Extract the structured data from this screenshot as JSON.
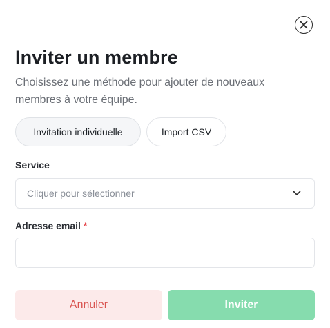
{
  "dialog": {
    "close_icon": "close-circle-icon",
    "title": "Inviter un membre",
    "subtitle": "Choisissez une méthode pour ajouter de nouveaux membres à votre équipe."
  },
  "tabs": [
    {
      "label": "Invitation individuelle",
      "active": true
    },
    {
      "label": "Import CSV",
      "active": false
    }
  ],
  "form": {
    "service": {
      "label": "Service",
      "placeholder": "Cliquer pour sélectionner",
      "icon": "chevron-down-icon"
    },
    "email": {
      "label": "Adresse email",
      "required_marker": "*",
      "value": "",
      "placeholder": ""
    }
  },
  "actions": {
    "cancel_label": "Annuler",
    "invite_label": "Inviter"
  },
  "colors": {
    "cancel_bg": "#fceaea",
    "cancel_text": "#d9534f",
    "invite_bg": "#86dcae",
    "required": "#e5484d"
  }
}
